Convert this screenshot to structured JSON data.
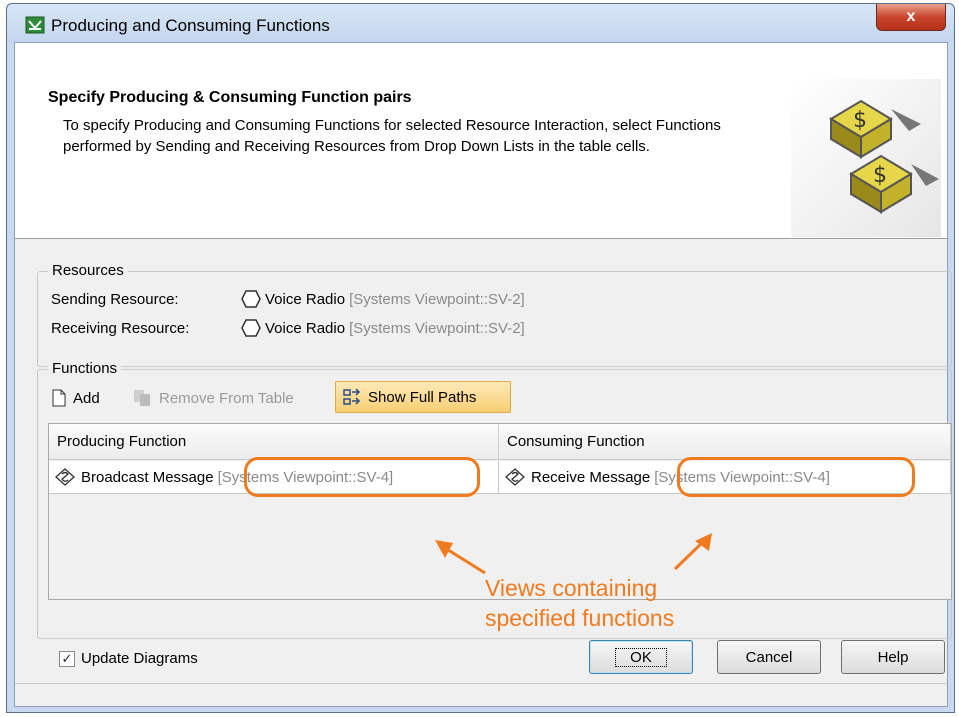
{
  "window": {
    "title": "Producing and Consuming Functions",
    "close_label": "x"
  },
  "header": {
    "title": "Specify Producing & Consuming Function pairs",
    "description": "To specify Producing and Consuming Functions for selected Resource Interaction, select Functions performed by Sending and Receiving Resources from Drop Down Lists in the table cells."
  },
  "resources": {
    "legend": "Resources",
    "sending": {
      "label": "Sending Resource:",
      "name": "Voice Radio",
      "path": "[Systems Viewpoint::SV-2]"
    },
    "receiving": {
      "label": "Receiving Resource:",
      "name": "Voice Radio",
      "path": "[Systems Viewpoint::SV-2]"
    }
  },
  "functions": {
    "legend": "Functions",
    "toolbar": {
      "add": "Add",
      "remove": "Remove From Table",
      "show_full_paths": "Show Full Paths"
    },
    "columns": [
      "Producing Function",
      "Consuming Function"
    ],
    "rows": [
      {
        "producing": {
          "name": "Broadcast Message",
          "path": "[Systems Viewpoint::SV-4]"
        },
        "consuming": {
          "name": "Receive Message",
          "path": "[Systems Viewpoint::SV-4]"
        }
      }
    ]
  },
  "annotation": {
    "line1": "Views containing",
    "line2": "specified functions",
    "color": "#f07a1e"
  },
  "update_diagrams": {
    "label": "Update Diagrams",
    "checked": true
  },
  "buttons": {
    "ok": "OK",
    "cancel": "Cancel",
    "help": "Help"
  },
  "colors": {
    "accent": "#f07a1e",
    "highlight": "#f8cf73",
    "titlebar": "#c9daf0"
  }
}
